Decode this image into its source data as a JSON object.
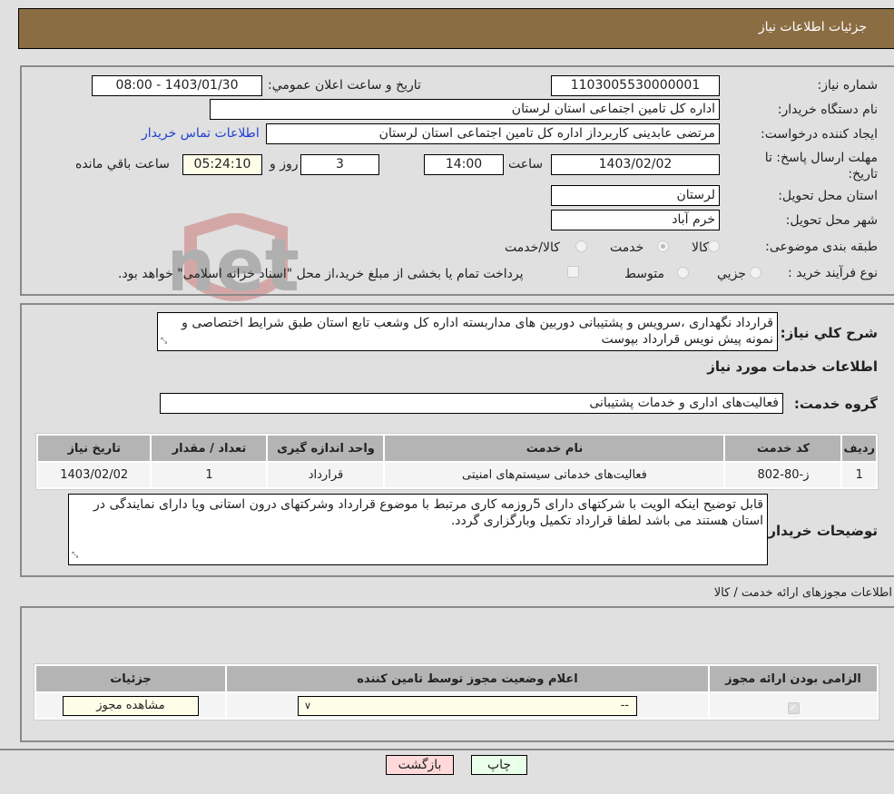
{
  "header": {
    "title": "جزئیات اطلاعات نیاز"
  },
  "form": {
    "need_number": {
      "label": "شماره نیاز:",
      "value": "1103005530000001"
    },
    "announce_datetime": {
      "label": "تاريخ و ساعت اعلان عمومي:",
      "value": "1403/01/30 - 08:00"
    },
    "buyer_org": {
      "label": "نام دستگاه خريدار:",
      "value": "اداره کل تامین اجتماعی استان لرستان"
    },
    "requester": {
      "label": "ايجاد کننده درخواست:",
      "value": "مرتضی عابدینی کاربرداز اداره کل تامین اجتماعی استان لرستان",
      "contact_link": "اطلاعات تماس خريدار"
    },
    "deadline": {
      "label": "مهلت ارسال پاسخ: تا تاريخ:",
      "date": "1403/02/02",
      "time_label": "ساعت",
      "time": "14:00",
      "days": "3",
      "days_label": "روز و",
      "remaining": "05:24:10",
      "remaining_label": "ساعت باقي مانده"
    },
    "delivery_province": {
      "label": "استان محل تحويل:",
      "value": "لرستان"
    },
    "delivery_city": {
      "label": "شهر محل تحويل:",
      "value": "خرم آباد"
    },
    "category": {
      "label": "طبقه بندی موضوعی:",
      "options": [
        "کالا",
        "خدمت",
        "کالا/خدمت"
      ],
      "selected": "خدمت"
    },
    "purchase_type": {
      "label": "نوع فرآيند خريد :",
      "options": [
        "جزيي",
        "متوسط"
      ],
      "treasury_note": "پرداخت تمام يا بخشی از مبلغ خريد،از محل \"اسناد خزانه اسلامی\" خواهد بود."
    }
  },
  "description": {
    "label": "شرح کلي نياز:",
    "value": "قرارداد نگهداری ،سرویس و پشتیبانی دوربین های مداربسته اداره کل وشعب تابع استان طبق شرایط اختصاصی و نمونه  پیش نویس قرارداد بپوست"
  },
  "services": {
    "section_title": "اطلاعات خدمات مورد نياز",
    "group_label": "گروه خدمت:",
    "group_value": "فعالیت‌های اداری و خدمات پشتیبانی",
    "columns": [
      "رديف",
      "کد خدمت",
      "نام خدمت",
      "واحد اندازه گيری",
      "تعداد / مقدار",
      "تاريخ نياز"
    ],
    "rows": [
      {
        "row": "1",
        "code": "ز-80-802",
        "name": "فعالیت‌های خدماتی سیستم‌های امنیتی",
        "unit": "قرارداد",
        "qty": "1",
        "date": "1403/02/02"
      }
    ]
  },
  "buyer_notes": {
    "label": "توضيحات خريدار:",
    "value": "قابل توضیح اینکه الویت با شرکتهای دارای 5روزمه کاری مرتبط با موضوع قرارداد وشرکتهای درون استانی ویا دارای نمایندگی در استان هستند می باشد لطفا قرارداد تکمیل وبارگزاری گردد."
  },
  "permits": {
    "section_title": "اطلاعات مجوزهای ارائه خدمت / کالا",
    "columns": [
      "الزامی بودن ارائه مجوز",
      "اعلام وضعیت مجوز توسط تامین کننده",
      "جزئیات"
    ],
    "rows": [
      {
        "required": true,
        "status": "--",
        "details_button": "مشاهده مجوز"
      }
    ]
  },
  "actions": {
    "print": "چاپ",
    "back": "بازگشت"
  },
  "watermark": "AriaTender.net",
  "colors": {
    "header": "#8b6d43",
    "back_button": "#ffd9d9",
    "print_button": "#eaffea",
    "link": "#1f3fd6"
  }
}
